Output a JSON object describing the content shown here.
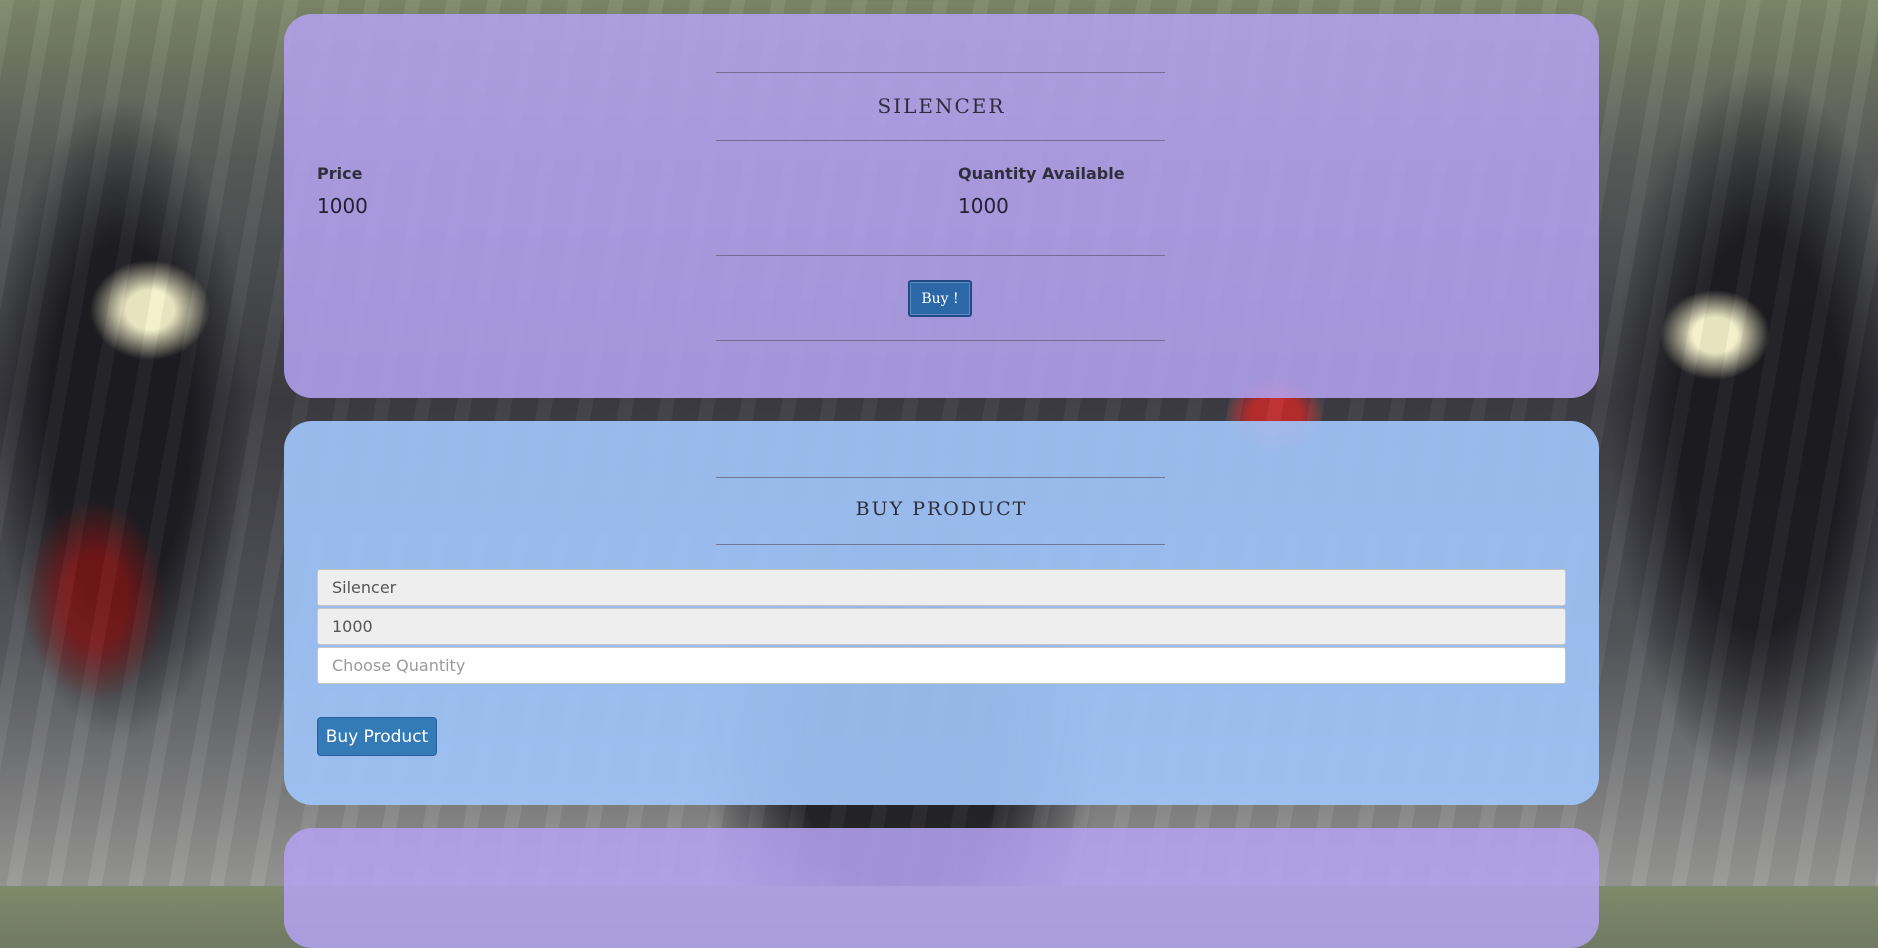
{
  "product_card": {
    "title": "SILENCER",
    "price_label": "Price",
    "price_value": "1000",
    "quantity_label": "Quantity Available",
    "quantity_value": "1000",
    "buy_button_label": "Buy !"
  },
  "buy_form": {
    "title": "BUY PRODUCT",
    "product_name_value": "Silencer",
    "price_value": "1000",
    "quantity_placeholder": "Choose Quantity",
    "submit_label": "Buy Product"
  },
  "colors": {
    "card_purple": "#b2a2ee",
    "card_blue": "#a0c4fa",
    "button_primary": "#337ab7",
    "button_dark": "#2c67a8"
  }
}
